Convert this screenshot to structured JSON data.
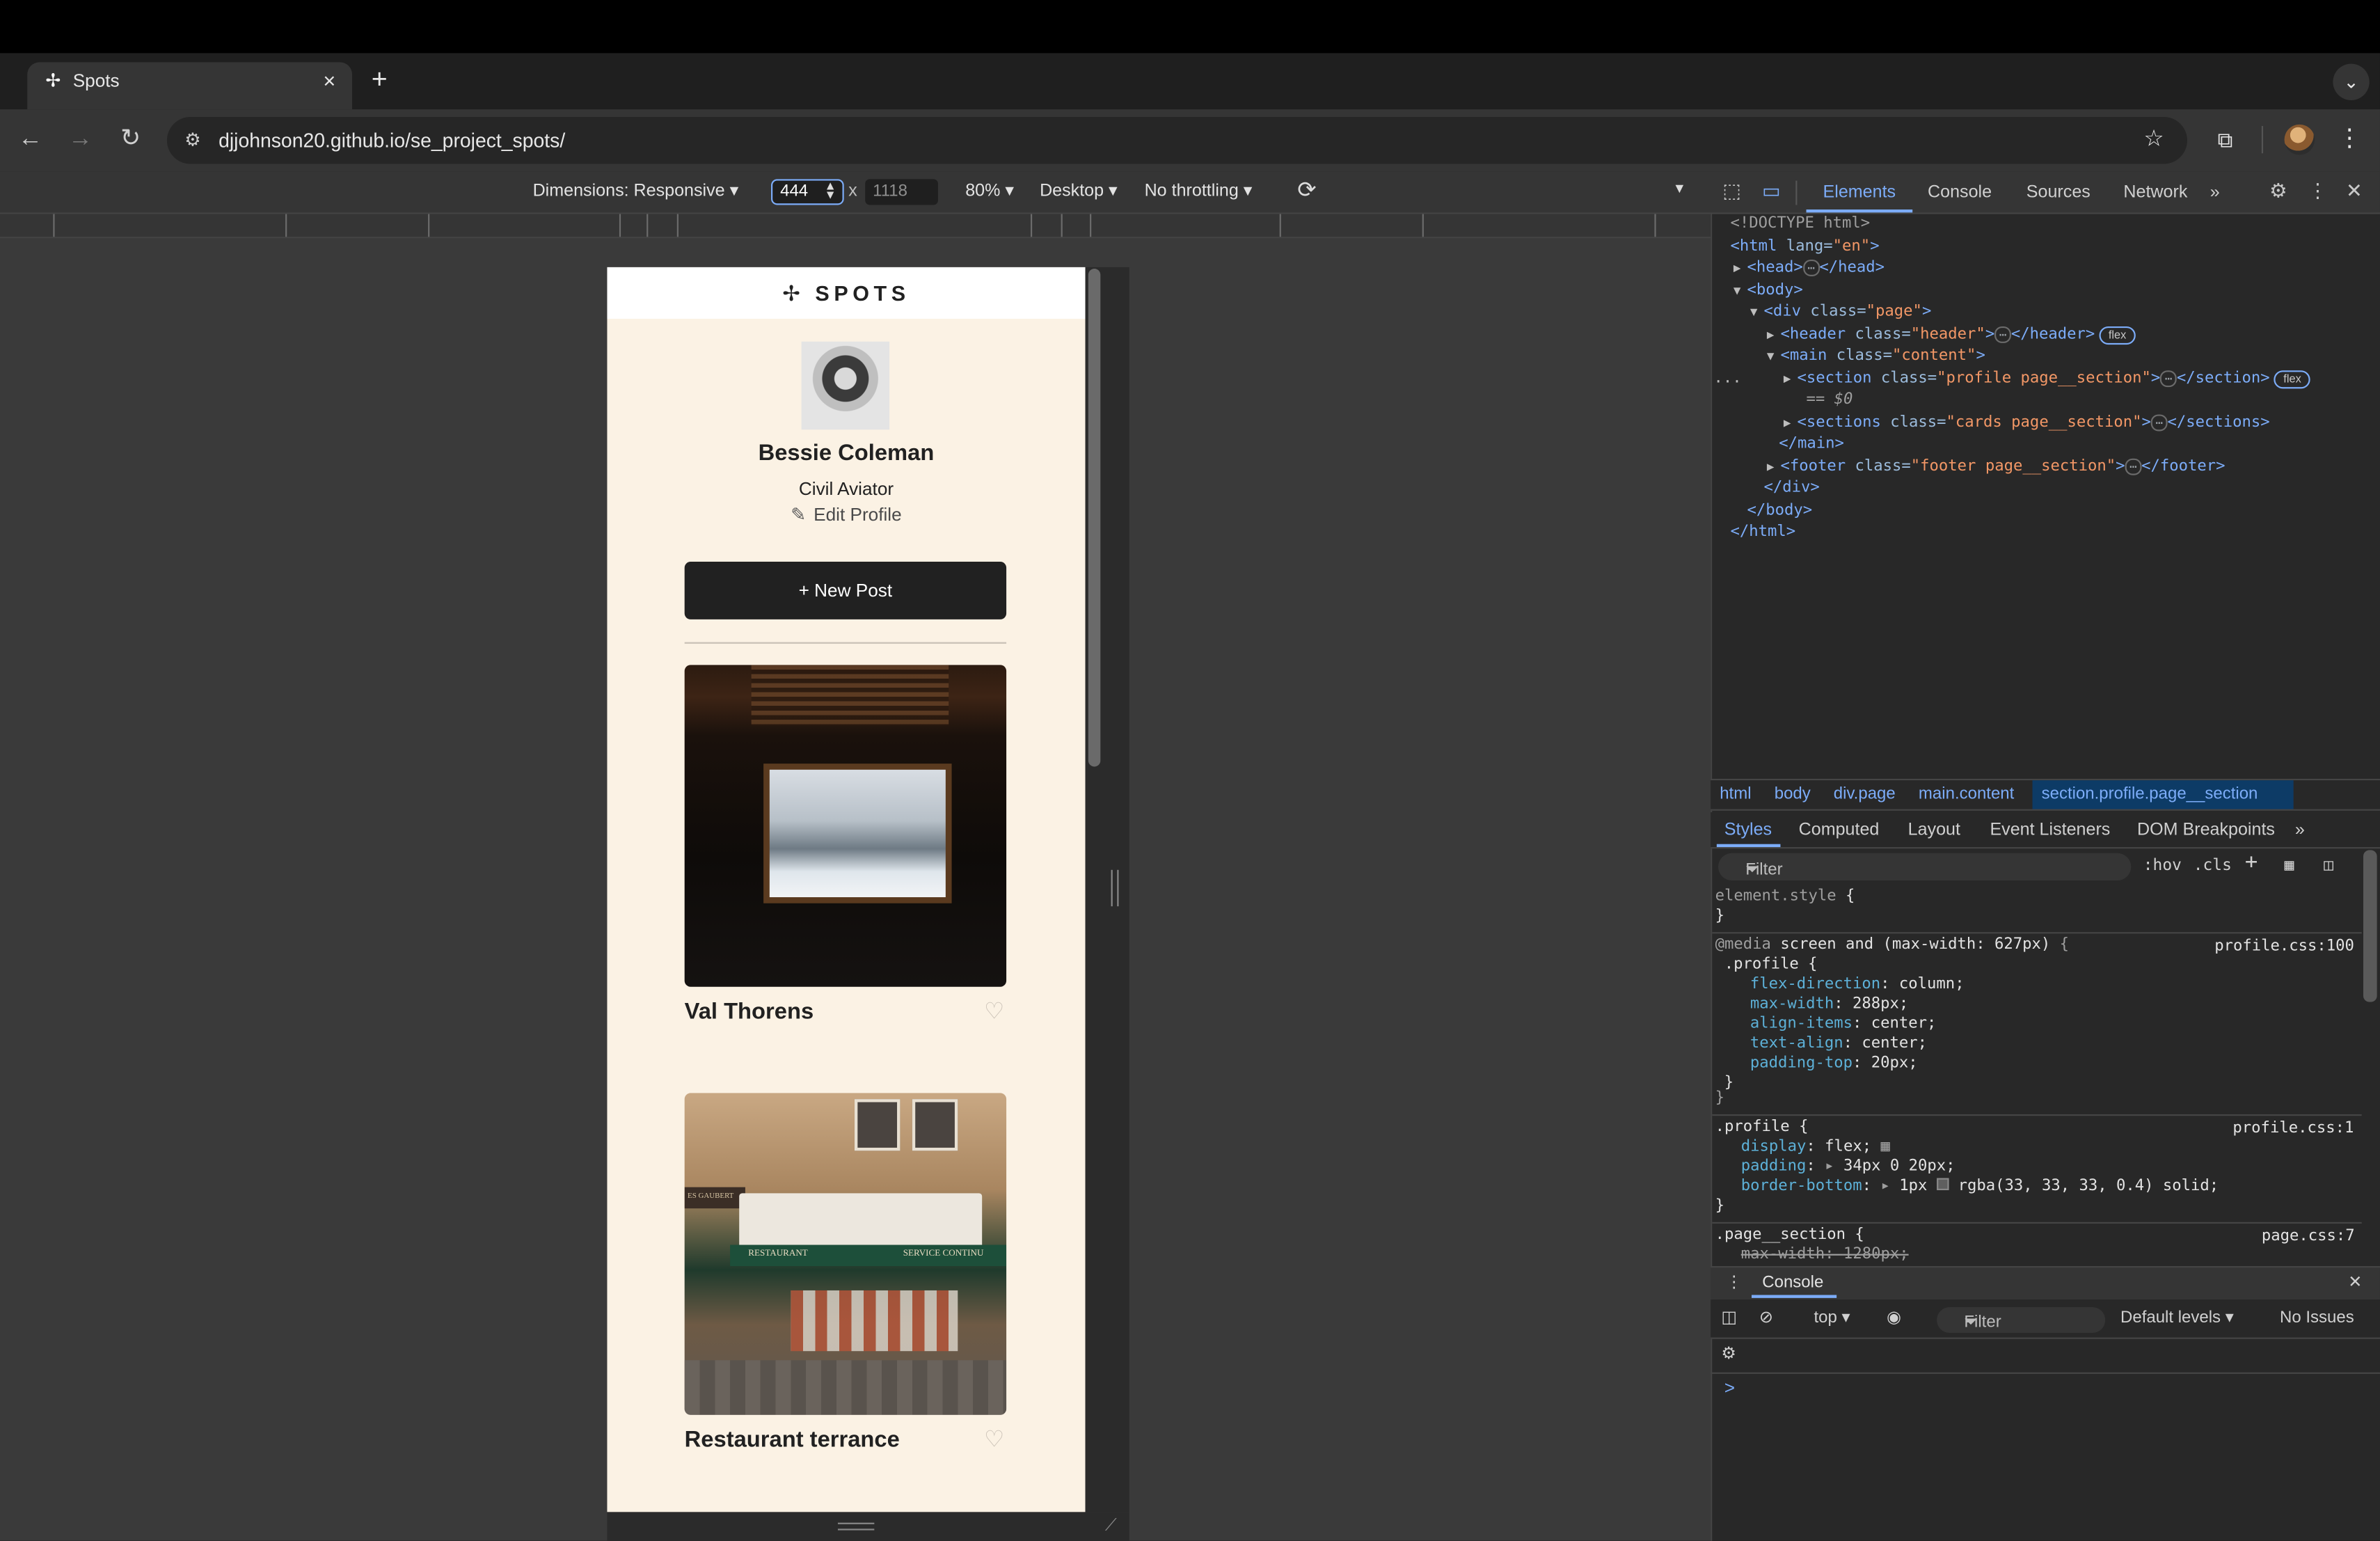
{
  "browser": {
    "tab_title": "Spots",
    "tab_favicon": "✢",
    "url": "djjohnson20.github.io/se_project_spots/"
  },
  "device_toolbar": {
    "dimensions_label": "Dimensions: Responsive",
    "width": "444",
    "times": "x",
    "height": "1118",
    "zoom": "80%",
    "device_type": "Desktop",
    "throttling": "No throttling"
  },
  "page": {
    "logo": "SPOTS",
    "profile": {
      "name": "Bessie Coleman",
      "description": "Civil Aviator",
      "edit_label": "Edit Profile"
    },
    "new_post_label": "New Post",
    "cards": [
      {
        "title": "Val Thorens"
      },
      {
        "title": "Restaurant terrance"
      }
    ],
    "photo_signs": {
      "awning_left": "RESTAURANT",
      "awning_right": "SERVICE CONTINU",
      "side": "ES GAUBERT"
    }
  },
  "devtools": {
    "tabs": [
      "Elements",
      "Console",
      "Sources",
      "Network"
    ],
    "active_tab": "Elements",
    "dom": {
      "doctype": "<!DOCTYPE html>",
      "html_open": "<html ",
      "html_attr": "lang=",
      "html_val": "\"en\"",
      "head": "<head>",
      "head_close": "</head>",
      "body": "<body>",
      "div_open": "<div ",
      "div_attr": "class=",
      "div_val": "\"page\"",
      "header_open": "<header ",
      "header_attr": "class=",
      "header_val": "\"header\"",
      "header_close": "</header>",
      "flex_badge": "flex",
      "main_open": "<main ",
      "main_attr": "class=",
      "main_val": "\"content\"",
      "section_open": "<section ",
      "section_attr": "class=",
      "section_val": "\"profile page__section\"",
      "section_close": "</section>",
      "sel_marker": "== $0",
      "sections_open": "<sections ",
      "sections_attr": "class=",
      "sections_val": "\"cards page__section\"",
      "sections_close": "</sections>",
      "main_close": "</main>",
      "footer_open": "<footer ",
      "footer_attr": "class=",
      "footer_val": "\"footer page__section\"",
      "footer_close": "</footer>",
      "div_close": "</div>",
      "body_close": "</body>",
      "html_close": "</html>",
      "gutter_dots": "..."
    },
    "breadcrumbs": [
      "html",
      "body",
      "div.page",
      "main.content",
      "section.profile.page__section"
    ],
    "styles_tabs": [
      "Styles",
      "Computed",
      "Layout",
      "Event Listeners",
      "DOM Breakpoints"
    ],
    "filter_placeholder": "Filter",
    "hov": ":hov",
    "cls": ".cls",
    "rules": {
      "element_style": "element.style {",
      "close": "}",
      "media_kw": "@media",
      "media_rest": " screen and (max-width: 627px) ",
      "media_link": "profile.css:100",
      "profile_sel": ".profile {",
      "m_props": [
        [
          "flex-direction",
          "column;"
        ],
        [
          "max-width",
          "288px;"
        ],
        [
          "align-items",
          "center;"
        ],
        [
          "text-align",
          "center;"
        ],
        [
          "padding-top",
          "20px;"
        ]
      ],
      "profile_link": "profile.css:1",
      "display": [
        "display",
        "flex;"
      ],
      "padding": [
        "padding",
        "34px 0 20px;"
      ],
      "border": [
        "border-bottom",
        "1px",
        "rgba(33, 33, 33, 0.4) solid;"
      ],
      "page_section_sel": ".page__section {",
      "page_link": "page.css:7",
      "strike": [
        "max-width",
        "1280px;"
      ]
    },
    "console": {
      "title": "Console",
      "context": "top",
      "filter": "Filter",
      "levels": "Default levels",
      "issues": "No Issues",
      "prompt": ">"
    }
  },
  "colors": {
    "page_bg": "#fbf2e4",
    "text": "#212121",
    "accent": "#7cacf8"
  }
}
